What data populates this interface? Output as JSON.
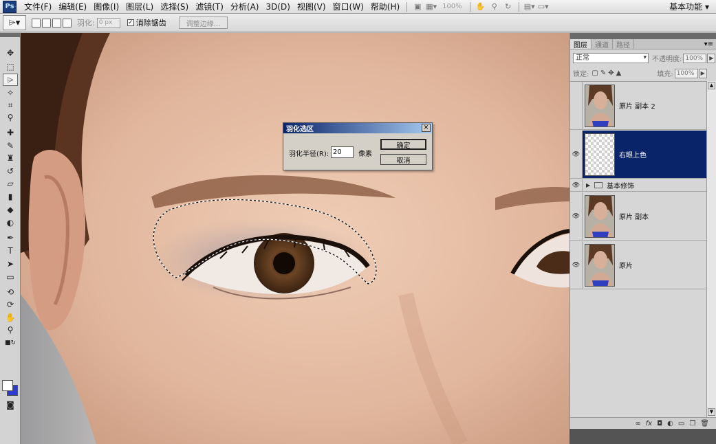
{
  "app": {
    "logo": "Ps"
  },
  "menu": [
    "文件(F)",
    "编辑(E)",
    "图像(I)",
    "图层(L)",
    "选择(S)",
    "滤镜(T)",
    "分析(A)",
    "3D(D)",
    "视图(V)",
    "窗口(W)",
    "帮助(H)"
  ],
  "menubar_right": {
    "zoom": "100%",
    "workspace": "基本功能 ▾"
  },
  "options": {
    "feather_label": "羽化:",
    "feather_value": "0 px",
    "antialias_label": "消除锯齿",
    "antialias_checked": true,
    "refine_button": "调整边缘..."
  },
  "dialog": {
    "title": "羽化选区",
    "radius_label": "羽化半径(R):",
    "radius_value": "20",
    "unit": "像素",
    "ok": "确定",
    "cancel": "取消"
  },
  "panel": {
    "tabs": [
      "图层",
      "通道",
      "路径"
    ],
    "blend_mode": "正常",
    "opacity_label": "不透明度:",
    "opacity_value": "100%",
    "lock_label": "锁定:",
    "fill_label": "填充:",
    "fill_value": "100%",
    "layers": [
      {
        "name": "原片 副本 2",
        "visible": false,
        "thumb": "photo"
      },
      {
        "name": "右眼上色",
        "visible": true,
        "thumb": "transparent",
        "selected": true
      },
      {
        "name": "基本修饰",
        "visible": true,
        "type": "group"
      },
      {
        "name": "原片 副本",
        "visible": true,
        "thumb": "photo"
      },
      {
        "name": "原片",
        "visible": true,
        "thumb": "photo"
      }
    ]
  },
  "colors": {
    "foreground": "#ffffff",
    "background": "#2d3bcc",
    "selected_layer": "#0a246a"
  },
  "icons": {
    "tools": [
      "move-icon",
      "marquee-icon",
      "polygonal-lasso-icon",
      "magic-wand-icon",
      "crop-icon",
      "eyedropper-icon",
      "healing-brush-icon",
      "brush-icon",
      "clone-stamp-icon",
      "history-brush-icon",
      "eraser-icon",
      "gradient-icon",
      "blur-icon",
      "dodge-icon",
      "pen-icon",
      "type-icon",
      "path-selection-icon",
      "rectangle-shape-icon",
      "3d-rotate-icon",
      "3d-orbit-icon",
      "hand-icon",
      "zoom-icon"
    ],
    "panel_footer": [
      "link-icon",
      "fx-icon",
      "mask-icon",
      "adjustment-icon",
      "folder-icon",
      "new-layer-icon",
      "trash-icon"
    ]
  }
}
